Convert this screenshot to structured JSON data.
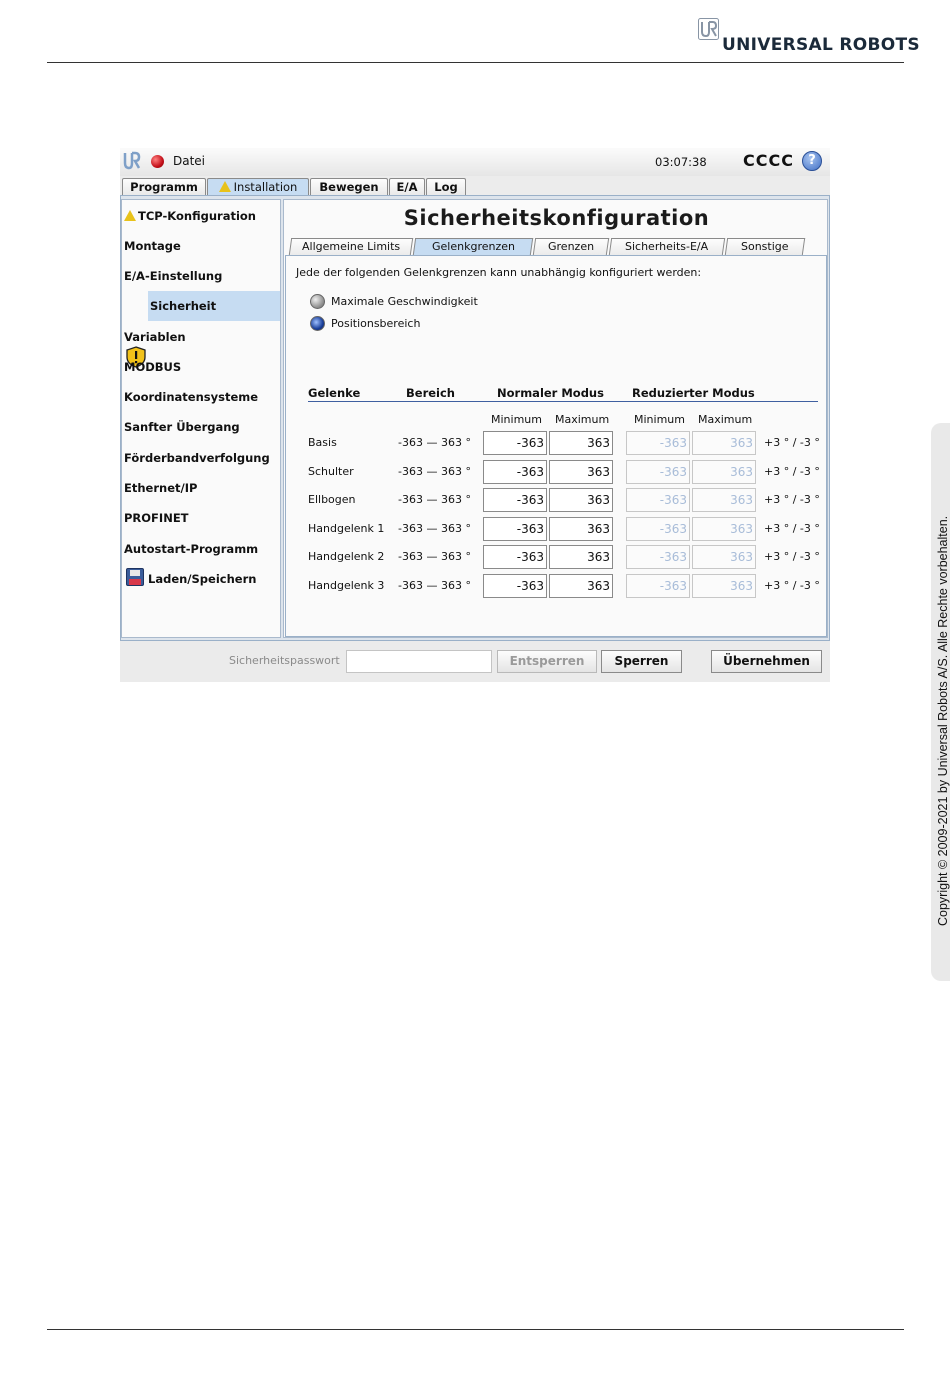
{
  "document": {
    "brand": "UNIVERSAL ROBOTS",
    "copyright": "Copyright © 2009-2021 by Universal Robots A/S. Alle Rechte vorbehalten."
  },
  "topbar": {
    "menu": "Datei",
    "time": "03:07:38",
    "robot_name": "CCCC",
    "help": "?"
  },
  "main_tabs": [
    {
      "label": "Programm",
      "active": false,
      "warning": false
    },
    {
      "label": "Installation",
      "active": true,
      "warning": true
    },
    {
      "label": "Bewegen",
      "active": false,
      "warning": false
    },
    {
      "label": "E/A",
      "active": false,
      "warning": false
    },
    {
      "label": "Log",
      "active": false,
      "warning": false
    }
  ],
  "sidebar": {
    "items": [
      {
        "label": "TCP-Konfiguration",
        "warning": true
      },
      {
        "label": "Montage"
      },
      {
        "label": "E/A-Einstellung"
      },
      {
        "label": "Sicherheit",
        "selected": true,
        "icon": "shield-warning-icon"
      },
      {
        "label": "Variablen"
      },
      {
        "label": "MODBUS"
      },
      {
        "label": "Koordinatensysteme"
      },
      {
        "label": "Sanfter Übergang"
      },
      {
        "label": "Förderbandverfolgung"
      },
      {
        "label": "Ethernet/IP"
      },
      {
        "label": "PROFINET"
      },
      {
        "label": "Autostart-Programm"
      },
      {
        "label": "Laden/Speichern",
        "icon": "floppy-disk-icon"
      }
    ]
  },
  "content": {
    "title": "Sicherheitskonfiguration",
    "tabs": [
      {
        "label": "Allgemeine Limits"
      },
      {
        "label": "Gelenkgrenzen",
        "active": true
      },
      {
        "label": "Grenzen"
      },
      {
        "label": "Sicherheits-E/A"
      },
      {
        "label": "Sonstige"
      }
    ],
    "intro": "Jede der folgenden Gelenkgrenzen kann unabhängig konfiguriert werden:",
    "options": [
      {
        "label": "Maximale Geschwindigkeit",
        "selected": false
      },
      {
        "label": "Positionsbereich",
        "selected": true
      }
    ],
    "table": {
      "headers": {
        "joints": "Gelenke",
        "range": "Bereich",
        "normal": "Normaler Modus",
        "reduced": "Reduzierter Modus"
      },
      "sub": {
        "min": "Minimum",
        "max": "Maximum"
      },
      "rows": [
        {
          "name": "Basis",
          "range": "-363 — 363 °",
          "n_min": "-363",
          "n_max": "363",
          "r_min": "-363",
          "r_max": "363",
          "tol": "+3 ° / -3 °"
        },
        {
          "name": "Schulter",
          "range": "-363 — 363 °",
          "n_min": "-363",
          "n_max": "363",
          "r_min": "-363",
          "r_max": "363",
          "tol": "+3 ° / -3 °"
        },
        {
          "name": "Ellbogen",
          "range": "-363 — 363 °",
          "n_min": "-363",
          "n_max": "363",
          "r_min": "-363",
          "r_max": "363",
          "tol": "+3 ° / -3 °"
        },
        {
          "name": "Handgelenk 1",
          "range": "-363 — 363 °",
          "n_min": "-363",
          "n_max": "363",
          "r_min": "-363",
          "r_max": "363",
          "tol": "+3 ° / -3 °"
        },
        {
          "name": "Handgelenk 2",
          "range": "-363 — 363 °",
          "n_min": "-363",
          "n_max": "363",
          "r_min": "-363",
          "r_max": "363",
          "tol": "+3 ° / -3 °"
        },
        {
          "name": "Handgelenk 3",
          "range": "-363 — 363 °",
          "n_min": "-363",
          "n_max": "363",
          "r_min": "-363",
          "r_max": "363",
          "tol": "+3 ° / -3 °"
        }
      ]
    }
  },
  "bottom": {
    "password_label": "Sicherheitspasswort",
    "password_value": "",
    "unlock": "Entsperren",
    "lock": "Sperren",
    "apply": "Übernehmen"
  },
  "colors": {
    "accent": "#c6dcf2",
    "warning": "#e8c21a",
    "brand": "#1b2a3a"
  }
}
